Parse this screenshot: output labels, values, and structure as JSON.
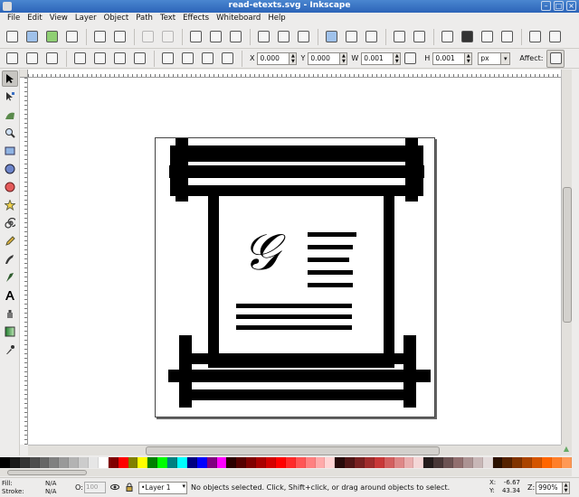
{
  "window": {
    "title": "read-etexts.svg - Inkscape"
  },
  "menubar": [
    "File",
    "Edit",
    "View",
    "Layer",
    "Object",
    "Path",
    "Text",
    "Effects",
    "Whiteboard",
    "Help"
  ],
  "toolbar": {
    "x_label": "X",
    "x_value": "0.000",
    "y_label": "Y",
    "y_value": "0.000",
    "w_label": "W",
    "w_value": "0.001",
    "h_label": "H",
    "h_value": "0.001",
    "unit": "px",
    "affect_label": "Affect:"
  },
  "palette": {
    "colors": [
      "#000000",
      "#1a1a1a",
      "#333333",
      "#4d4d4d",
      "#666666",
      "#808080",
      "#999999",
      "#b3b3b3",
      "#cccccc",
      "#e6e6e6",
      "#ffffff",
      "#800000",
      "#ff0000",
      "#808000",
      "#ffff00",
      "#008000",
      "#00ff00",
      "#008080",
      "#00ffff",
      "#000080",
      "#0000ff",
      "#800080",
      "#ff00ff",
      "#2b0000",
      "#550000",
      "#800000",
      "#aa0000",
      "#d40000",
      "#ff0000",
      "#ff2a2a",
      "#ff5555",
      "#ff8080",
      "#ffaaaa",
      "#ffd5d5",
      "#280b0b",
      "#501616",
      "#782121",
      "#a02c2c",
      "#c83737",
      "#d35f5f",
      "#de8787",
      "#e9afaf",
      "#f4d7d7",
      "#241c1c",
      "#483737",
      "#6c5353",
      "#916f6f",
      "#ac9393",
      "#c8b7b7",
      "#e3dbdb",
      "#2b1100",
      "#552200",
      "#803300",
      "#aa4400",
      "#d45500",
      "#ff6600",
      "#ff7f2a",
      "#ff9955"
    ]
  },
  "statusbar": {
    "fill_label": "Fill:",
    "stroke_label": "Stroke:",
    "fill_value": "N/A",
    "stroke_value": "N/A",
    "opacity_label": "O:",
    "opacity_value": "100",
    "layer": "•Layer 1",
    "message": "No objects selected. Click, Shift+click, or drag around objects to select.",
    "x_label": "X:",
    "y_label": "Y:",
    "x_value": "-6.67",
    "y_value": "43.34",
    "zoom_label": "Z:",
    "zoom_value": "990%"
  }
}
